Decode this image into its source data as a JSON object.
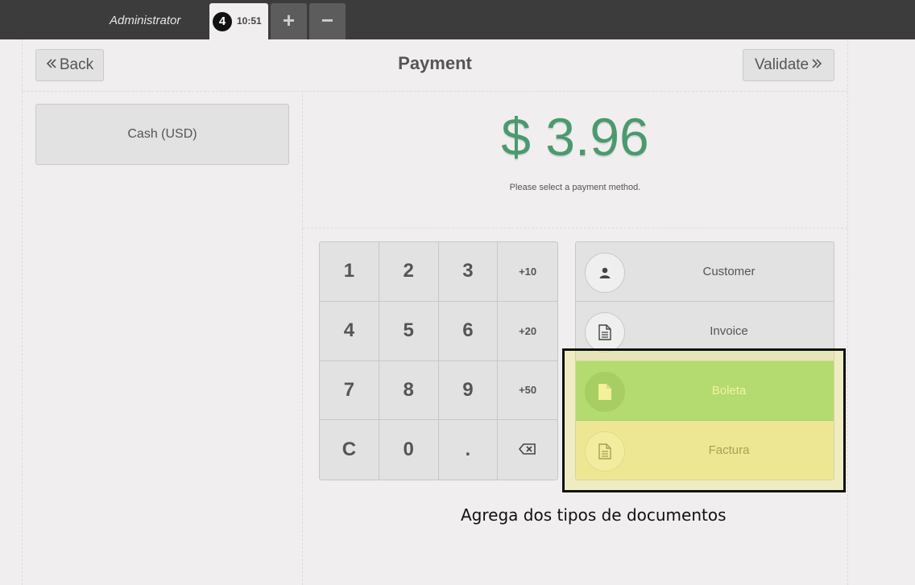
{
  "topbar": {
    "user": "Administrator",
    "order_number": "4",
    "order_time": "10:51",
    "add_label": "+",
    "remove_label": "−"
  },
  "header": {
    "back_label": "Back",
    "title": "Payment",
    "validate_label": "Validate"
  },
  "payment_methods": [
    {
      "label": "Cash (USD)"
    }
  ],
  "summary": {
    "total": "$ 3.96",
    "hint": "Please select a payment method."
  },
  "numpad": {
    "keys": [
      "1",
      "2",
      "3",
      "+10",
      "4",
      "5",
      "6",
      "+20",
      "7",
      "8",
      "9",
      "+50",
      "C",
      "0",
      ".",
      "⌫"
    ]
  },
  "actions": {
    "customer": "Customer",
    "invoice": "Invoice",
    "boleta": "Boleta",
    "factura": "Factura"
  },
  "annotation": {
    "caption": "Agrega dos tipos de documentos"
  },
  "colors": {
    "topbar": "#3c3c3c",
    "total": "#4a9a6e",
    "boleta_selected": "#93d470",
    "factura": "#ece7a8",
    "highlight_border": "#111111"
  },
  "icons": {
    "back": "chevron-double-left-icon",
    "validate": "chevron-double-right-icon",
    "customer": "user-icon",
    "invoice": "document-lines-icon",
    "boleta": "document-icon",
    "factura": "document-lines-icon",
    "backspace": "backspace-icon"
  }
}
